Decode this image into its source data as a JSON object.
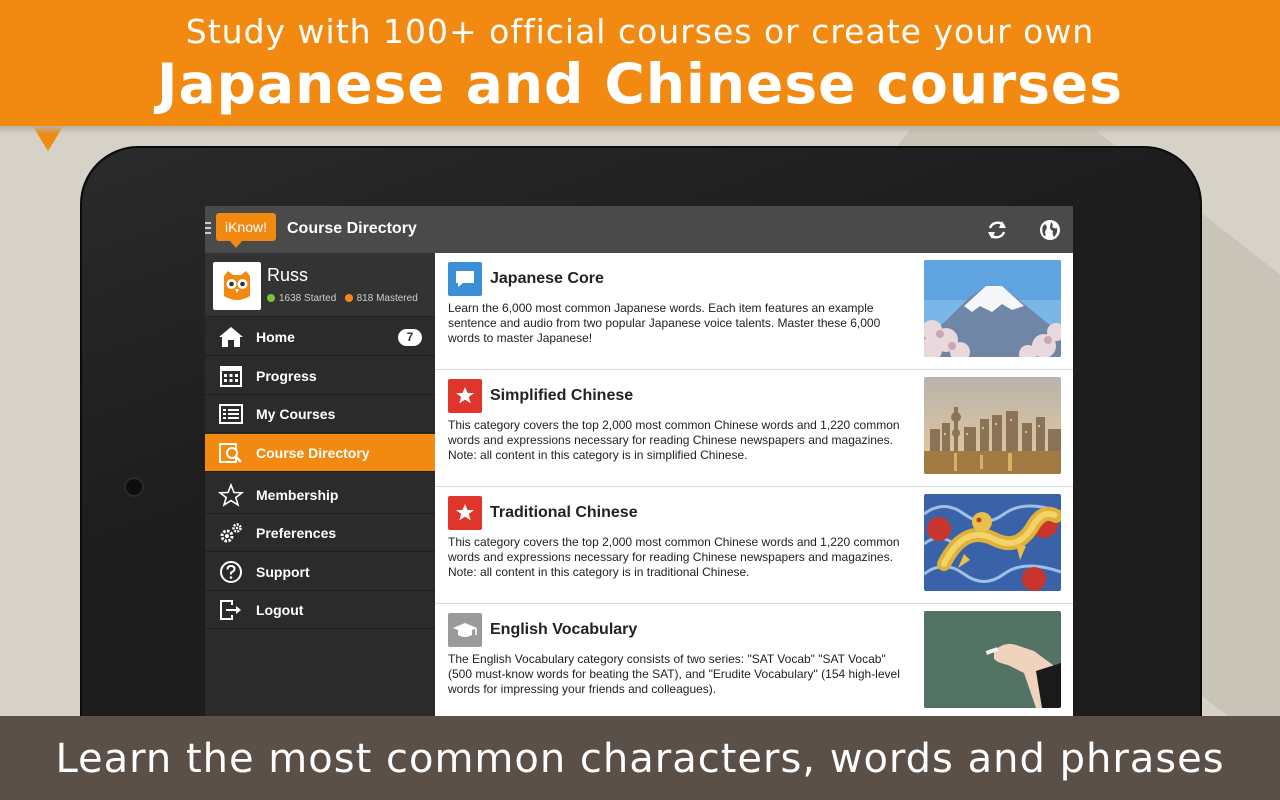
{
  "banner": {
    "line1": "Study with 100+ official courses or create your own",
    "line2": "Japanese and Chinese courses"
  },
  "bottom_banner": {
    "text": "Learn the most common characters, words and phrases"
  },
  "colors": {
    "brand_orange": "#f28a12",
    "actionbar": "#4a4a4a",
    "sidebar": "#2b2b2b",
    "bottom_banner": "#5a5047"
  },
  "app": {
    "logo": "iKnow!",
    "title": "Course Directory",
    "actions": [
      {
        "icon": "refresh-icon"
      },
      {
        "icon": "globe-icon"
      }
    ]
  },
  "profile": {
    "name": "Russ",
    "started": "1638 Started",
    "mastered": "818 Mastered",
    "avatar_icon": "owl-icon"
  },
  "sidebar": {
    "items": [
      {
        "label": "Home",
        "icon": "home-icon",
        "badge": "7"
      },
      {
        "label": "Progress",
        "icon": "calendar-icon"
      },
      {
        "label": "My Courses",
        "icon": "list-icon"
      },
      {
        "label": "Course Directory",
        "icon": "search-directory-icon",
        "active": true
      },
      {
        "label": "Membership",
        "icon": "star-icon"
      },
      {
        "label": "Preferences",
        "icon": "gears-icon"
      },
      {
        "label": "Support",
        "icon": "help-icon"
      },
      {
        "label": "Logout",
        "icon": "logout-icon"
      }
    ]
  },
  "courses": [
    {
      "title": "Japanese Core",
      "icon": "speech-bubble-icon",
      "icon_color": "#3a8fd6",
      "description": "Learn the 6,000 most common Japanese words. Each item features an example sentence and audio from two popular Japanese voice talents. Master these 6,000 words to master Japanese!",
      "image": "mount-fuji-image"
    },
    {
      "title": "Simplified Chinese",
      "icon": "star-flag-icon",
      "icon_color": "#e0352b",
      "description": "This category covers the top 2,000 most common Chinese words and 1,220 common words and expressions necessary for reading Chinese newspapers and magazines. Note: all content in this category is in simplified Chinese.",
      "image": "shanghai-skyline-image"
    },
    {
      "title": "Traditional Chinese",
      "icon": "star-flag-icon",
      "icon_color": "#e0352b",
      "description": "This category covers the top 2,000 most common Chinese words and 1,220 common words and expressions necessary for reading Chinese newspapers and magazines. Note: all content in this category is in traditional Chinese.",
      "image": "dragon-image"
    },
    {
      "title": "English Vocabulary",
      "icon": "graduation-cap-icon",
      "icon_color": "#9a9a9a",
      "description": "The English Vocabulary category consists of two series: \"SAT Vocab\" \"SAT Vocab\" (500 must-know words for beating the SAT), and \"Erudite Vocabulary\" (154 high-level words for impressing your friends and colleagues).",
      "image": "chalkboard-image"
    }
  ]
}
